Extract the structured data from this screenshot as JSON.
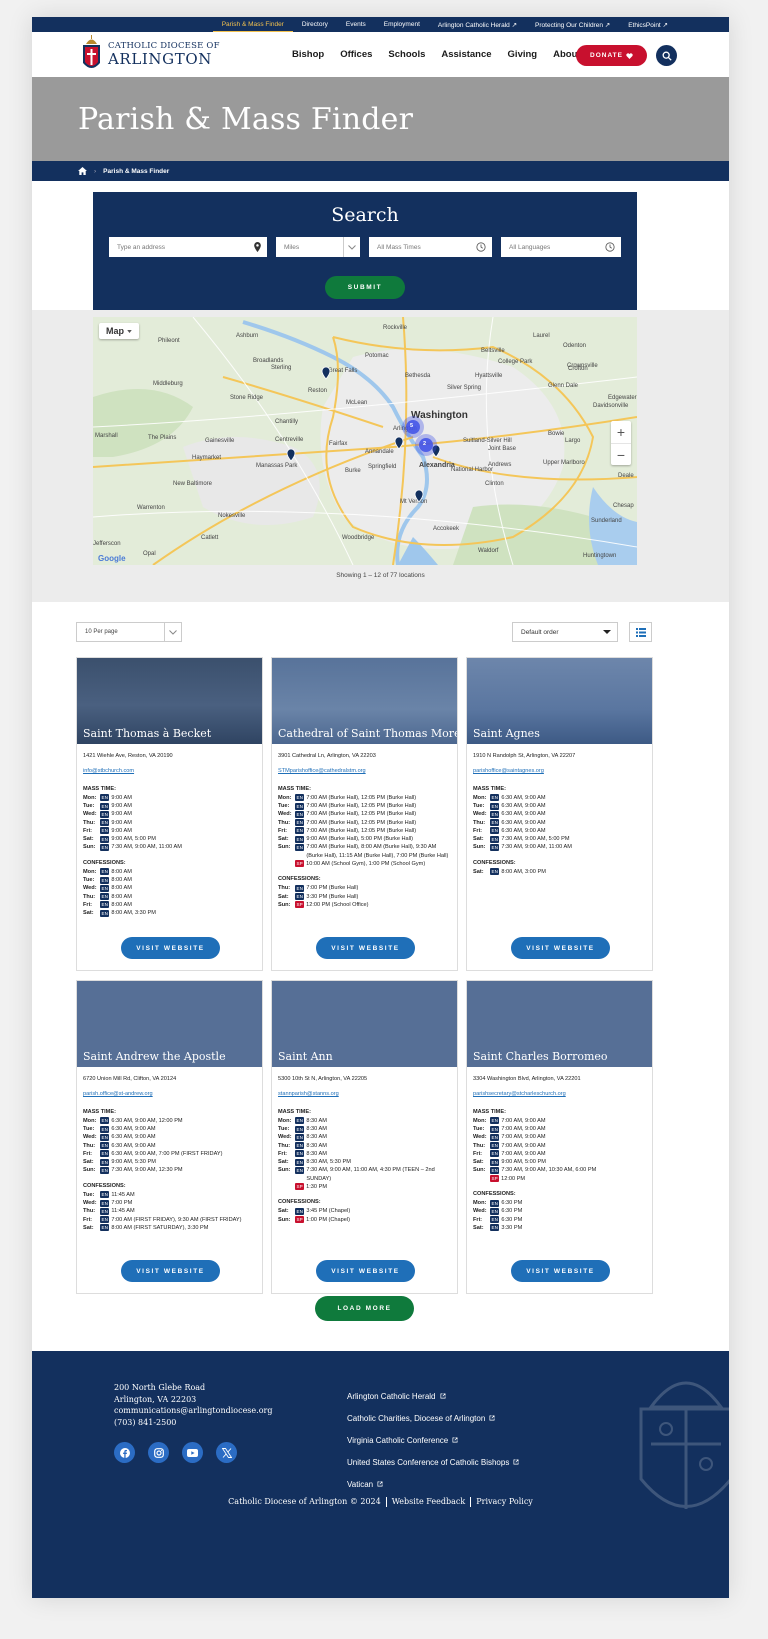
{
  "topbar": {
    "links": [
      "Parish & Mass Finder",
      "Directory",
      "Events",
      "Employment",
      "Arlington Catholic Herald ↗",
      "Protecting Our Children ↗",
      "EthicsPoint ↗"
    ]
  },
  "header": {
    "logo_line1": "Catholic Diocese of",
    "logo_line2": "Arlington",
    "nav": [
      "Bishop",
      "Offices",
      "Schools",
      "Assistance",
      "Giving",
      "About"
    ],
    "donate_label": "DONATE"
  },
  "hero": {
    "title": "Parish & Mass Finder"
  },
  "breadcrumb": {
    "current": "Parish & Mass Finder"
  },
  "search": {
    "title": "Search",
    "address_placeholder": "Type an address",
    "units_value": "Miles",
    "times_value": "All Mass Times",
    "languages_value": "All Languages",
    "submit_label": "SUBMIT"
  },
  "map": {
    "type_button": "Map",
    "labels": [
      "Rockville",
      "Potomac",
      "Bethesda",
      "Washington",
      "Arlington",
      "Alexandria",
      "Annandale",
      "Springfield",
      "Fairfax",
      "Reston",
      "Centreville",
      "Manassas",
      "Gainesville",
      "Haymarket",
      "Leesburg",
      "Sterling",
      "Chantilly",
      "Burke",
      "Woodbridge",
      "Mt Vernon",
      "Clinton",
      "Waldorf",
      "Bowie",
      "Upper Marlboro",
      "College Park",
      "Beltsville",
      "Silver Spring",
      "Laurel",
      "Crofton",
      "Ashburn",
      "Broadlands",
      "Purcellville",
      "Middleburg",
      "The Plains",
      "Marshall",
      "Warrenton",
      "Nokesville",
      "Catlett",
      "Opal",
      "Remington",
      "Dale City",
      "Stone Ridge",
      "Aldie",
      "Phileont",
      "Great Falls",
      "McLean",
      "Oxon Hill",
      "National Harbor",
      "Largo",
      "Accokeek",
      "Indian Head",
      "Huntingtown",
      "Edgewater",
      "Davidsonville",
      "Joint Base Andrews",
      "Suitland-Silver Hill",
      "Hyattsville",
      "Lanham",
      "Glenn Dale",
      "New Baltimore",
      "Sunderland",
      "Chesapeake Beach",
      "Deale",
      "Elkwood",
      "Bristow",
      "Herndon",
      "Lincolnia",
      "Dumfries",
      "Triangle",
      "Marlton"
    ],
    "clusters": [
      "5",
      "2"
    ],
    "google_label": "Google",
    "showing_text": "Showing 1 – 12 of 77 locations"
  },
  "controls": {
    "per_page": "10 Per page",
    "order": "Default order"
  },
  "parishes": [
    {
      "name": "Saint Thomas à Becket",
      "address": "1421 Wiehle Ave, Reston, VA 20190",
      "email": "info@stbchurch.com",
      "mass_label": "MASS TIME:",
      "mass": [
        {
          "day": "Mon:",
          "lang": "EN",
          "time": "9:00 AM"
        },
        {
          "day": "Tue:",
          "lang": "EN",
          "time": "9:00 AM"
        },
        {
          "day": "Wed:",
          "lang": "EN",
          "time": "9:00 AM"
        },
        {
          "day": "Thu:",
          "lang": "EN",
          "time": "9:00 AM"
        },
        {
          "day": "Fri:",
          "lang": "EN",
          "time": "9:00 AM"
        },
        {
          "day": "Sat:",
          "lang": "EN",
          "time": "9:00 AM, 5:00 PM"
        },
        {
          "day": "Sun:",
          "lang": "EN",
          "time": "7:30 AM, 9:00 AM, 11:00 AM"
        }
      ],
      "conf_label": "CONFESSIONS:",
      "confessions": [
        {
          "day": "Mon:",
          "lang": "EN",
          "time": "8:00 AM"
        },
        {
          "day": "Tue:",
          "lang": "EN",
          "time": "8:00 AM"
        },
        {
          "day": "Wed:",
          "lang": "EN",
          "time": "8:00 AM"
        },
        {
          "day": "Thu:",
          "lang": "EN",
          "time": "8:00 AM"
        },
        {
          "day": "Fri:",
          "lang": "EN",
          "time": "8:00 AM"
        },
        {
          "day": "Sat:",
          "lang": "EN",
          "time": "8:00 AM, 3:30 PM"
        }
      ],
      "button": "VISIT WEBSITE"
    },
    {
      "name": "Cathedral of Saint Thomas More",
      "address": "3901 Cathedral Ln, Arlington, VA 22203",
      "email": "STMparishoffice@cathedralstm.org",
      "mass_label": "MASS TIME:",
      "mass": [
        {
          "day": "Mon:",
          "lang": "EN",
          "time": "7:00 AM (Burke Hall), 12:05 PM (Burke Hall)"
        },
        {
          "day": "Tue:",
          "lang": "EN",
          "time": "7:00 AM (Burke Hall), 12:05 PM (Burke Hall)"
        },
        {
          "day": "Wed:",
          "lang": "EN",
          "time": "7:00 AM (Burke Hall), 12:05 PM (Burke Hall)"
        },
        {
          "day": "Thu:",
          "lang": "EN",
          "time": "7:00 AM (Burke Hall), 12:05 PM (Burke Hall)"
        },
        {
          "day": "Fri:",
          "lang": "EN",
          "time": "7:00 AM (Burke Hall), 12:05 PM (Burke Hall)"
        },
        {
          "day": "Sat:",
          "lang": "EN",
          "time": "9:00 AM (Burke Hall), 5:00 PM (Burke Hall)"
        },
        {
          "day": "Sun:",
          "lang": "EN",
          "time": "7:00 AM (Burke Hall), 8:00 AM (Burke Hall), 9:30 AM (Burke Hall), 11:15 AM (Burke Hall), 7:00 PM (Burke Hall)"
        },
        {
          "day": "",
          "lang": "SP",
          "time": "10:00 AM (School Gym), 1:00 PM (School Gym)"
        }
      ],
      "conf_label": "CONFESSIONS:",
      "confessions": [
        {
          "day": "Thu:",
          "lang": "EN",
          "time": "7:00 PM (Burke Hall)"
        },
        {
          "day": "Sat:",
          "lang": "EN",
          "time": "3:30 PM (Burke Hall)"
        },
        {
          "day": "Sun:",
          "lang": "SP",
          "time": "12:00 PM (School Office)"
        }
      ],
      "button": "VISIT WEBSITE"
    },
    {
      "name": "Saint Agnes",
      "address": "1910 N Randolph St, Arlington, VA 22207",
      "email": "parishoffice@saintagnes.org",
      "mass_label": "MASS TIME:",
      "mass": [
        {
          "day": "Mon:",
          "lang": "EN",
          "time": "6:30 AM, 9:00 AM"
        },
        {
          "day": "Tue:",
          "lang": "EN",
          "time": "6:30 AM, 9:00 AM"
        },
        {
          "day": "Wed:",
          "lang": "EN",
          "time": "6:30 AM, 9:00 AM"
        },
        {
          "day": "Thu:",
          "lang": "EN",
          "time": "6:30 AM, 9:00 AM"
        },
        {
          "day": "Fri:",
          "lang": "EN",
          "time": "6:30 AM, 9:00 AM"
        },
        {
          "day": "Sat:",
          "lang": "EN",
          "time": "7:30 AM, 9:00 AM, 5:00 PM"
        },
        {
          "day": "Sun:",
          "lang": "EN",
          "time": "7:30 AM, 9:00 AM, 11:00 AM"
        }
      ],
      "conf_label": "CONFESSIONS:",
      "confessions": [
        {
          "day": "Sat:",
          "lang": "EN",
          "time": "8:00 AM, 3:00 PM"
        }
      ],
      "button": "VISIT WEBSITE"
    },
    {
      "name": "Saint Andrew the Apostle",
      "address": "6720 Union Mill Rd, Clifton, VA 20124",
      "email": "parish.office@st-andrew.org",
      "mass_label": "MASS TIME:",
      "mass": [
        {
          "day": "Mon:",
          "lang": "EN",
          "time": "6:30 AM, 9:00 AM, 12:00 PM"
        },
        {
          "day": "Tue:",
          "lang": "EN",
          "time": "6:30 AM, 9:00 AM"
        },
        {
          "day": "Wed:",
          "lang": "EN",
          "time": "6:30 AM, 9:00 AM"
        },
        {
          "day": "Thu:",
          "lang": "EN",
          "time": "6:30 AM, 9:00 AM"
        },
        {
          "day": "Fri:",
          "lang": "EN",
          "time": "6:30 AM, 9:00 AM, 7:00 PM (FIRST FRIDAY)"
        },
        {
          "day": "Sat:",
          "lang": "EN",
          "time": "9:00 AM, 5:30 PM"
        },
        {
          "day": "Sun:",
          "lang": "EN",
          "time": "7:30 AM, 9:00 AM, 12:30 PM"
        }
      ],
      "conf_label": "CONFESSIONS:",
      "confessions": [
        {
          "day": "Tue:",
          "lang": "EN",
          "time": "11:45 AM"
        },
        {
          "day": "Wed:",
          "lang": "EN",
          "time": "7:00 PM"
        },
        {
          "day": "Thu:",
          "lang": "EN",
          "time": "11:45 AM"
        },
        {
          "day": "Fri:",
          "lang": "EN",
          "time": "7:00 AM (FIRST FRIDAY), 9:30 AM (FIRST FRIDAY)"
        },
        {
          "day": "Sat:",
          "lang": "EN",
          "time": "8:00 AM (FIRST SATURDAY), 3:30 PM"
        }
      ],
      "button": "VISIT WEBSITE"
    },
    {
      "name": "Saint Ann",
      "address": "5300 10th St N, Arlington, VA 22205",
      "email": "stannparish@stanns.org",
      "mass_label": "MASS TIME:",
      "mass": [
        {
          "day": "Mon:",
          "lang": "EN",
          "time": "8:30 AM"
        },
        {
          "day": "Tue:",
          "lang": "EN",
          "time": "8:30 AM"
        },
        {
          "day": "Wed:",
          "lang": "EN",
          "time": "8:30 AM"
        },
        {
          "day": "Thu:",
          "lang": "EN",
          "time": "8:30 AM"
        },
        {
          "day": "Fri:",
          "lang": "EN",
          "time": "8:30 AM"
        },
        {
          "day": "Sat:",
          "lang": "EN",
          "time": "8:30 AM, 5:30 PM"
        },
        {
          "day": "Sun:",
          "lang": "EN",
          "time": "7:30 AM, 9:00 AM, 11:00 AM, 4:30 PM (TEEN – 2nd SUNDAY)"
        },
        {
          "day": "",
          "lang": "SP",
          "time": "1:30 PM"
        }
      ],
      "conf_label": "CONFESSIONS:",
      "confessions": [
        {
          "day": "Sat:",
          "lang": "EN",
          "time": "3:45 PM (Chapel)"
        },
        {
          "day": "Sun:",
          "lang": "SP",
          "time": "1:00 PM (Chapel)"
        }
      ],
      "button": "VISIT WEBSITE"
    },
    {
      "name": "Saint Charles Borromeo",
      "address": "3304 Washington Blvd, Arlington, VA 22201",
      "email": "parishsecretary@stcharleschurch.org",
      "mass_label": "MASS TIME:",
      "mass": [
        {
          "day": "Mon:",
          "lang": "EN",
          "time": "7:00 AM, 9:00 AM"
        },
        {
          "day": "Tue:",
          "lang": "EN",
          "time": "7:00 AM, 9:00 AM"
        },
        {
          "day": "Wed:",
          "lang": "EN",
          "time": "7:00 AM, 9:00 AM"
        },
        {
          "day": "Thu:",
          "lang": "EN",
          "time": "7:00 AM, 9:00 AM"
        },
        {
          "day": "Fri:",
          "lang": "EN",
          "time": "7:00 AM, 9:00 AM"
        },
        {
          "day": "Sat:",
          "lang": "EN",
          "time": "9:00 AM, 5:00 PM"
        },
        {
          "day": "Sun:",
          "lang": "EN",
          "time": "7:30 AM, 9:00 AM, 10:30 AM, 6:00 PM"
        },
        {
          "day": "",
          "lang": "SP",
          "time": "12:00 PM"
        }
      ],
      "conf_label": "CONFESSIONS:",
      "confessions": [
        {
          "day": "Mon:",
          "lang": "EN",
          "time": "6:30 PM"
        },
        {
          "day": "Wed:",
          "lang": "EN",
          "time": "6:30 PM"
        },
        {
          "day": "Fri:",
          "lang": "EN",
          "time": "6:30 PM"
        },
        {
          "day": "Sat:",
          "lang": "EN",
          "time": "3:30 PM"
        }
      ],
      "button": "VISIT WEBSITE"
    }
  ],
  "load_more": "LOAD MORE",
  "footer": {
    "address1": "200 North Glebe Road",
    "address2": "Arlington, VA 22203",
    "email": "communications@arlingtondiocese.org",
    "phone": "(703) 841-2500",
    "links": [
      "Arlington Catholic Herald",
      "Catholic Charities, Diocese of Arlington",
      "Virginia Catholic Conference",
      "United States Conference of Catholic Bishops",
      "Vatican"
    ],
    "copyright": "Catholic Diocese of Arlington © 2024",
    "feedback": "Website Feedback",
    "privacy": "Privacy Policy"
  },
  "colors": {
    "navy": "#13305e",
    "red": "#c8102e",
    "green": "#0f7a3c",
    "blue": "#1f6fb8",
    "gold": "#f2c14e"
  }
}
